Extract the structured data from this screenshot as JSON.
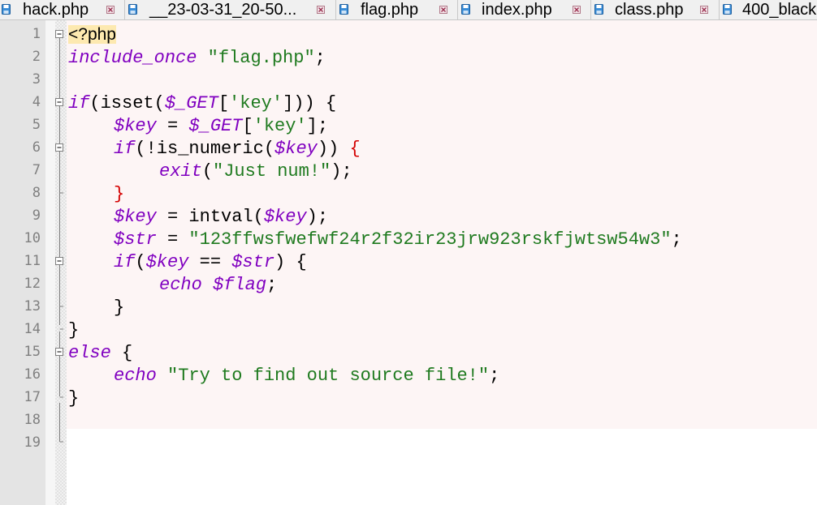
{
  "tabs": [
    {
      "label": "hack.php",
      "icon": "floppy-disk-icon",
      "close": "close-tab-icon"
    },
    {
      "label": "__23-03-31_20-50...",
      "icon": "floppy-disk-icon",
      "close": "close-tab-icon"
    },
    {
      "label": "flag.php",
      "icon": "floppy-disk-icon",
      "close": "close-tab-icon"
    },
    {
      "label": "index.php",
      "icon": "floppy-disk-icon",
      "close": "close-tab-icon"
    },
    {
      "label": "class.php",
      "icon": "floppy-disk-icon",
      "close": "close-tab-icon"
    },
    {
      "label": "400_black",
      "icon": "floppy-disk-icon",
      "close": "close-tab-icon"
    }
  ],
  "editor": {
    "line_numbers": [
      "1",
      "2",
      "3",
      "4",
      "5",
      "6",
      "7",
      "8",
      "9",
      "10",
      "11",
      "12",
      "13",
      "14",
      "15",
      "16",
      "17",
      "18",
      "19"
    ],
    "lines": {
      "l1": {
        "tag": "<?php"
      },
      "l2": {
        "kw": "include_once",
        "sp": " ",
        "str": "\"flag.php\"",
        "end": ";"
      },
      "l4": {
        "kw": "if",
        "a": "(isset(",
        "var": "$_GET",
        "b": "[",
        "str": "'key'",
        "c": "])) {"
      },
      "l5": {
        "var1": "$key",
        "a": " = ",
        "var2": "$_GET",
        "b": "[",
        "str": "'key'",
        "c": "];"
      },
      "l6": {
        "kw": "if",
        "a": "(!is_numeric(",
        "var": "$key",
        "b": ")) ",
        "brace": "{"
      },
      "l7": {
        "kw": "exit",
        "a": "(",
        "str": "\"Just num!\"",
        "b": ");"
      },
      "l8": {
        "brace": "}"
      },
      "l9": {
        "var1": "$key",
        "a": " = intval(",
        "var2": "$key",
        "b": ");"
      },
      "l10": {
        "var": "$str",
        "a": " = ",
        "str": "\"123ffwsfwefwf24r2f32ir23jrw923rskfjwtsw54w3\"",
        "b": ";"
      },
      "l11": {
        "kw": "if",
        "a": "(",
        "var1": "$key",
        "b": " == ",
        "var2": "$str",
        "c": ") {"
      },
      "l12": {
        "kw": "echo",
        "sp": " ",
        "var": "$flag",
        "end": ";"
      },
      "l13": {
        "brace": "}"
      },
      "l14": {
        "brace": "}"
      },
      "l15": {
        "kw": "else",
        "b": " {"
      },
      "l16": {
        "kw": "echo",
        "sp": " ",
        "str": "\"Try to find out source file!\"",
        "end": ";"
      },
      "l17": {
        "brace": "}"
      }
    }
  }
}
